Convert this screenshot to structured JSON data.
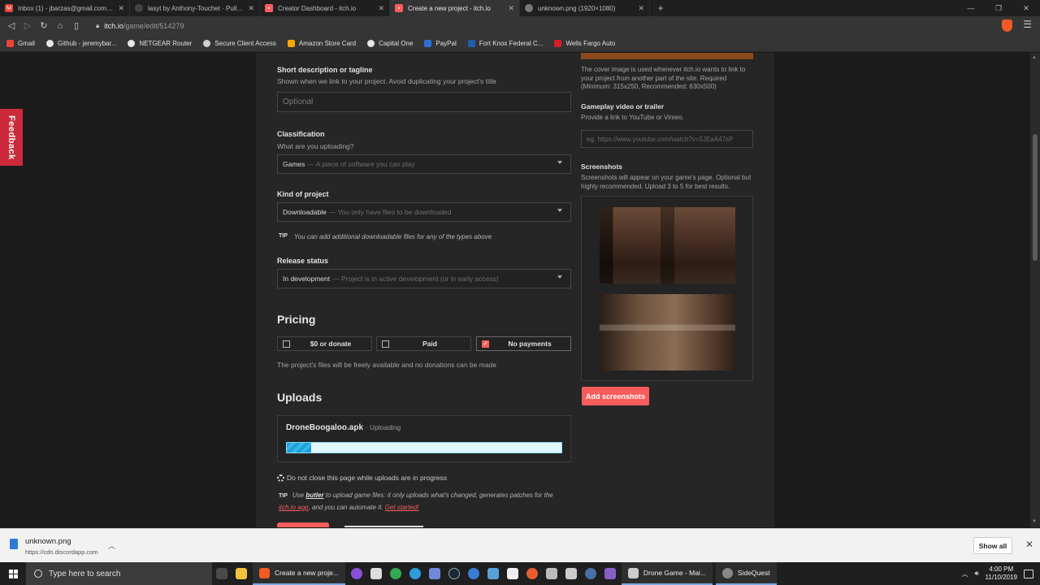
{
  "browser": {
    "tabs": [
      {
        "title": "Inbox (1) - jbarzas@gmail.com - G",
        "icon": "gmail-icon",
        "color": "#ea4335"
      },
      {
        "title": "lasyt by Anthony-Touchet · Pull Re",
        "icon": "github-icon",
        "color": "#333333"
      },
      {
        "title": "Creator Dashboard - itch.io",
        "icon": "itchio-icon",
        "color": "#fa5c5c"
      },
      {
        "title": "Create a new project - itch.io",
        "icon": "itchio-icon",
        "color": "#fa5c5c"
      },
      {
        "title": "unknown.png (1920×1080)",
        "icon": "globe-icon",
        "color": "#888888"
      }
    ],
    "url_host": "itch.io",
    "url_path": "/game/edit/514279",
    "bookmarks": [
      {
        "label": "Gmail",
        "color": "#ea4335"
      },
      {
        "label": "Github - jeremybar...",
        "color": "#e6e6e6"
      },
      {
        "label": "NETGEAR Router",
        "color": "#e6e6e6"
      },
      {
        "label": "Secure Client Access",
        "color": "#f4b400"
      },
      {
        "label": "Amazon Store Card",
        "color": "#f7a800"
      },
      {
        "label": "Capital One",
        "color": "#e6e6e6"
      },
      {
        "label": "PayPal",
        "color": "#2d6fd6"
      },
      {
        "label": "Fort Knox Federal C...",
        "color": "#1e5fae"
      },
      {
        "label": "Wells Fargo Auto",
        "color": "#d71e28"
      }
    ]
  },
  "feedback_label": "Feedback",
  "form": {
    "short_desc": {
      "label": "Short description or tagline",
      "help": "Shown when we link to your project. Avoid duplicating your project's title",
      "placeholder": "Optional"
    },
    "classification": {
      "label": "Classification",
      "help": "What are you uploading?",
      "value": "Games",
      "hint": "— A piece of software you can play"
    },
    "kind": {
      "label": "Kind of project",
      "value": "Downloadable",
      "hint": "— You only have files to be downloaded",
      "tip_tag": "TIP",
      "tip": "You can add additional downloadable files for any of the types above"
    },
    "release": {
      "label": "Release status",
      "value": "In development",
      "hint": "— Project is in active development (or in early access)"
    },
    "pricing": {
      "title": "Pricing",
      "options": [
        {
          "label": "$0 or donate",
          "checked": false
        },
        {
          "label": "Paid",
          "checked": false
        },
        {
          "label": "No payments",
          "checked": true
        }
      ],
      "note": "The project's files will be freely available and no donations can be made"
    },
    "uploads": {
      "title": "Uploads",
      "file_name": "DroneBoogaloo.apk",
      "status": "· Uploading",
      "progress": 0.09,
      "warning": "Do not close this page while uploads are in progress",
      "tip_tag": "TIP",
      "tip_pre": "Use ",
      "tip_butler": "butler",
      "tip_mid": " to upload game files: it only uploads what's changed, generates patches for the ",
      "tip_app": "itch.io app",
      "tip_post": ", and you can automate it. ",
      "tip_link": "Get started!"
    }
  },
  "sidebar": {
    "cover_help": "The cover image is used whenever itch.io wants to link to your project from another part of the site. Required (Minimum: 315x250, Recommended: 630x500)",
    "video_label": "Gameplay video or trailer",
    "video_help": "Provide a link to YouTube or Vimeo.",
    "video_placeholder": "eg. https://www.youtube.com/watch?v=5JEaA47sP",
    "screens_label": "Screenshots",
    "screens_help": "Screenshots will appear on your game's page. Optional but highly recommended. Upload 3 to 5 for best results.",
    "add_button": "Add screenshots"
  },
  "downloads": {
    "file": "unknown.png",
    "source": "https://cdn.discordapp.com",
    "show_all": "Show all"
  },
  "taskbar": {
    "search_placeholder": "Type here to search",
    "apps": [
      {
        "label": "Create a new proje...",
        "color": "#f05a24"
      },
      {
        "label": "Drone Game - Mai...",
        "color": "#cccccc"
      },
      {
        "label": "SideQuest",
        "color": "#888888"
      }
    ],
    "time": "4:00 PM",
    "date": "11/10/2019"
  }
}
